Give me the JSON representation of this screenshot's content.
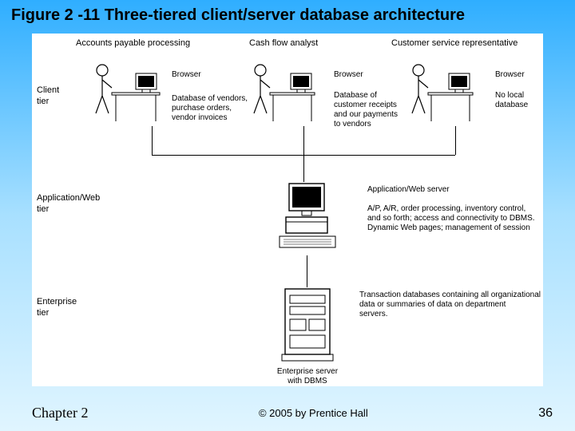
{
  "title": "Figure 2 -11 Three-tiered client/server database architecture",
  "footer": {
    "chapter": "Chapter 2",
    "copyright": "© 2005 by Prentice Hall",
    "page": "36"
  },
  "tiers": {
    "client": "Client\ntier",
    "app": "Application/Web\ntier",
    "enterprise": "Enterprise\ntier"
  },
  "columns": {
    "accounts": "Accounts payable processing",
    "cashflow": "Cash flow analyst",
    "csr": "Customer service representative"
  },
  "browser": "Browser",
  "client_desc": {
    "accounts": "Database of vendors,\npurchase orders,\nvendor invoices",
    "cashflow": "Database of\ncustomer receipts\nand our payments\nto vendors",
    "csr": "No local\ndatabase"
  },
  "app_server": {
    "label": "Application/Web server",
    "desc": "A/P, A/R, order processing, inventory control,\nand so forth; access and connectivity to DBMS.\nDynamic Web pages; management of session"
  },
  "enterprise_server": {
    "label": "Enterprise server\nwith DBMS",
    "desc": "Transaction databases containing all organizational\ndata or summaries of data on department\nservers."
  }
}
